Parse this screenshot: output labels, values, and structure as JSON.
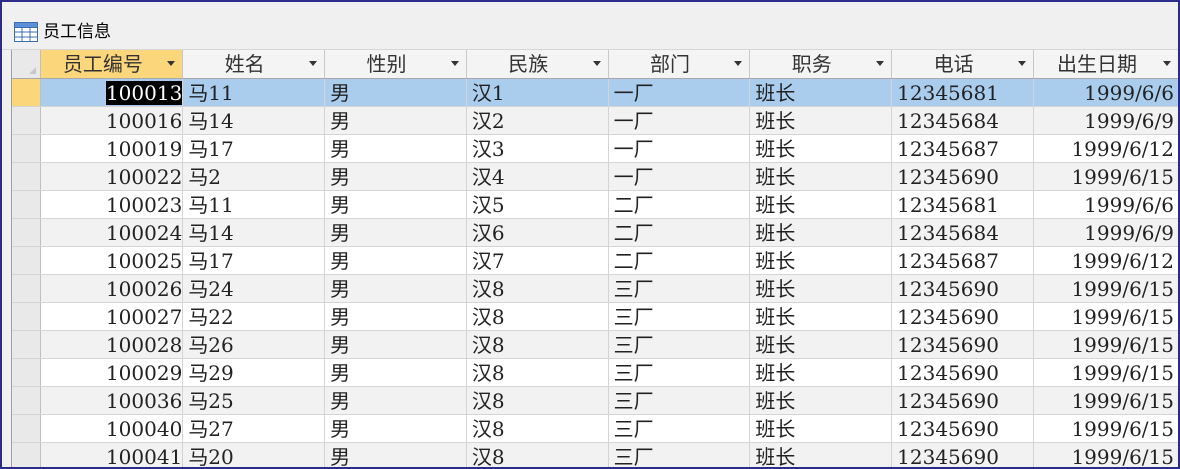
{
  "window": {
    "title": "员工信息",
    "icon": "table-icon"
  },
  "columns": [
    {
      "key": "id",
      "label": "员工编号"
    },
    {
      "key": "name",
      "label": "姓名"
    },
    {
      "key": "gender",
      "label": "性别"
    },
    {
      "key": "ethnicity",
      "label": "民族"
    },
    {
      "key": "dept",
      "label": "部门"
    },
    {
      "key": "position",
      "label": "职务"
    },
    {
      "key": "phone",
      "label": "电话"
    },
    {
      "key": "birth",
      "label": "出生日期"
    }
  ],
  "rows": [
    [
      "100013",
      "马11",
      "男",
      "汉1",
      "一厂",
      "班长",
      "12345681",
      "1999/6/6"
    ],
    [
      "100016",
      "马14",
      "男",
      "汉2",
      "一厂",
      "班长",
      "12345684",
      "1999/6/9"
    ],
    [
      "100019",
      "马17",
      "男",
      "汉3",
      "一厂",
      "班长",
      "12345687",
      "1999/6/12"
    ],
    [
      "100022",
      "马2",
      "男",
      "汉4",
      "一厂",
      "班长",
      "12345690",
      "1999/6/15"
    ],
    [
      "100023",
      "马11",
      "男",
      "汉5",
      "二厂",
      "班长",
      "12345681",
      "1999/6/6"
    ],
    [
      "100024",
      "马14",
      "男",
      "汉6",
      "二厂",
      "班长",
      "12345684",
      "1999/6/9"
    ],
    [
      "100025",
      "马17",
      "男",
      "汉7",
      "二厂",
      "班长",
      "12345687",
      "1999/6/12"
    ],
    [
      "100026",
      "马24",
      "男",
      "汉8",
      "三厂",
      "班长",
      "12345690",
      "1999/6/15"
    ],
    [
      "100027",
      "马22",
      "男",
      "汉8",
      "三厂",
      "班长",
      "12345690",
      "1999/6/15"
    ],
    [
      "100028",
      "马26",
      "男",
      "汉8",
      "三厂",
      "班长",
      "12345690",
      "1999/6/15"
    ],
    [
      "100029",
      "马29",
      "男",
      "汉8",
      "三厂",
      "班长",
      "12345690",
      "1999/6/15"
    ],
    [
      "100036",
      "马25",
      "男",
      "汉8",
      "三厂",
      "班长",
      "12345690",
      "1999/6/15"
    ],
    [
      "100040",
      "马27",
      "男",
      "汉8",
      "三厂",
      "班长",
      "12345690",
      "1999/6/15"
    ],
    [
      "100041",
      "马20",
      "男",
      "汉8",
      "三厂",
      "班长",
      "12345690",
      "1999/6/15"
    ]
  ],
  "new_row_marker": "*",
  "colors": {
    "selected_row": "#aacdee",
    "selected_header": "#fbd67a",
    "alt_row": "#f2f2f2",
    "frame_border": "#2b2b8c"
  }
}
